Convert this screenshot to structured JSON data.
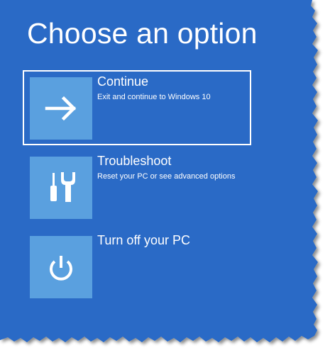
{
  "title": "Choose an option",
  "colors": {
    "background": "#2a6bc6",
    "tile": "#5aa0df",
    "text": "#ffffff"
  },
  "options": [
    {
      "label": "Continue",
      "description": "Exit and continue to Windows 10",
      "icon": "arrow-right-icon",
      "selected": true
    },
    {
      "label": "Troubleshoot",
      "description": "Reset your PC or see advanced options",
      "icon": "tools-icon",
      "selected": false
    },
    {
      "label": "Turn off your PC",
      "description": "",
      "icon": "power-icon",
      "selected": false
    }
  ]
}
